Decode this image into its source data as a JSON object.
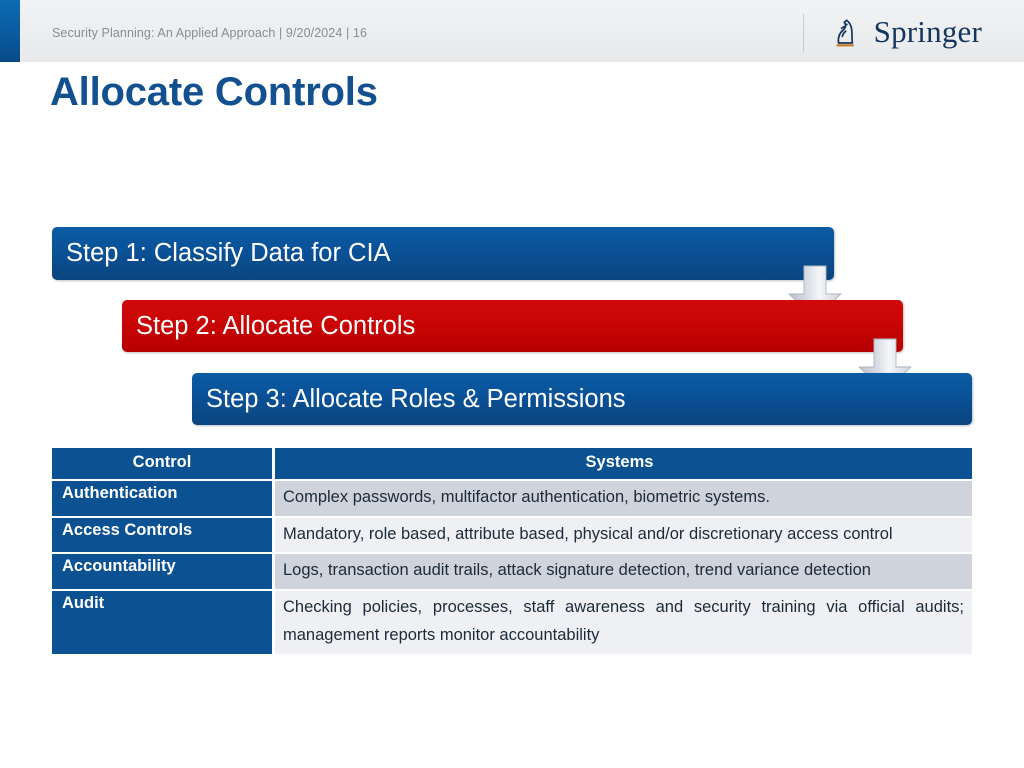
{
  "header": {
    "meta_text": "Security Planning: An Applied Approach | 9/20/2024 | 16",
    "accent_color": "#0a5ca0",
    "logo": {
      "wordmark": "Springer",
      "mark_name": "springer-knight-logo",
      "underline_color": "#c8781e"
    }
  },
  "slide": {
    "title": "Allocate Controls"
  },
  "process": {
    "steps": [
      {
        "label": "Step 1: Classify Data for CIA",
        "color": "#0a5299"
      },
      {
        "label": "Step 2: Allocate Controls",
        "color": "#ca0505"
      },
      {
        "label": "Step 3: Allocate Roles & Permissions",
        "color": "#0a5299"
      }
    ],
    "arrows": [
      {
        "name": "down-arrow-step1-to-step2"
      },
      {
        "name": "down-arrow-step2-to-step3"
      }
    ]
  },
  "table": {
    "headers": [
      "Control",
      "Systems"
    ],
    "header_bg": "#0c5191",
    "rows": [
      {
        "control": "Authentication",
        "systems": "Complex passwords, multifactor authentication, biometric systems."
      },
      {
        "control": "Access Controls",
        "systems": "Mandatory, role based, attribute based, physical and/or discretionary access control"
      },
      {
        "control": "Accountability",
        "systems": "Logs, transaction audit trails, attack signature detection, trend variance detection"
      },
      {
        "control": "Audit",
        "systems": "Checking policies, processes, staff awareness and security training via official audits; management reports monitor accountability"
      }
    ]
  }
}
